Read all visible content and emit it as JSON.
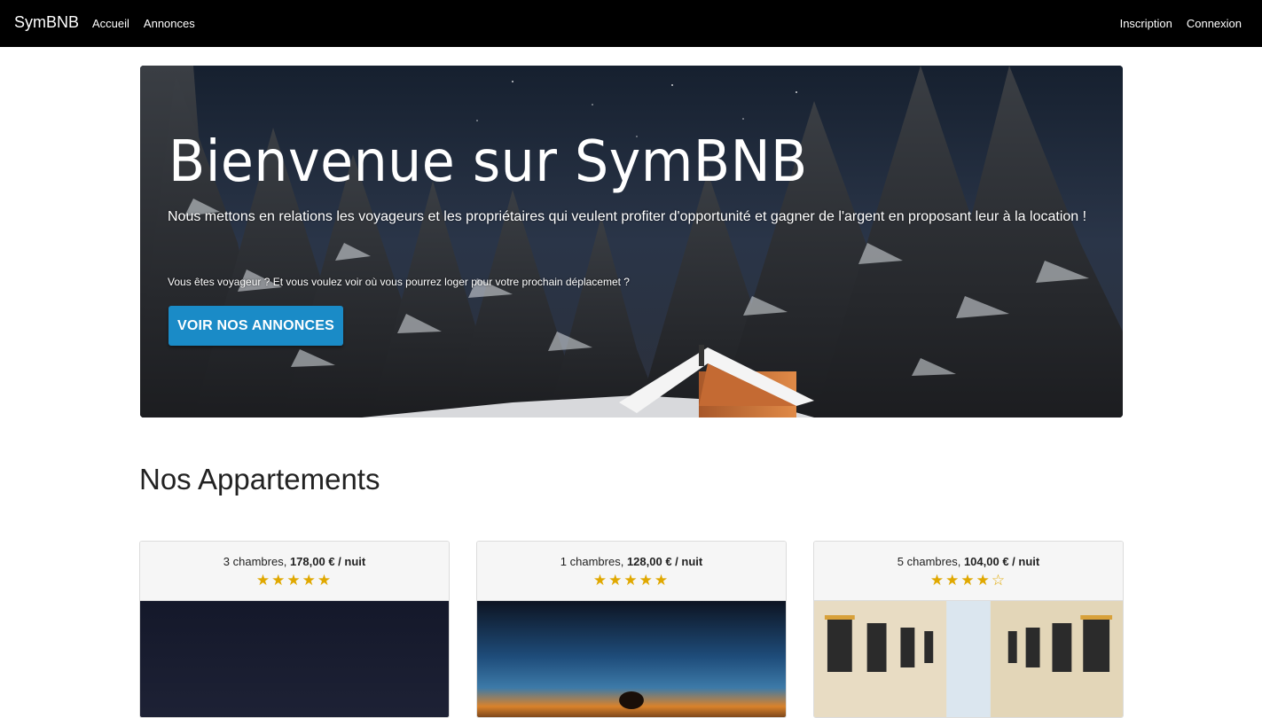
{
  "navbar": {
    "brand": "SymBNB",
    "left_links": [
      "Accueil",
      "Annonces"
    ],
    "right_links": [
      "Inscription",
      "Connexion"
    ]
  },
  "hero": {
    "title": "Bienvenue sur SymBNB",
    "lead": "Nous mettons en relations les voyageurs et les propriétaires qui veulent profiter d'opportunité et gagner de l'argent en proposant leur à la location !",
    "small": "Vous êtes voyageur ? Et vous voulez voir où vous pourrez loger pour votre prochain déplacemet ?",
    "button": "VOIR NOS ANNONCES"
  },
  "section": {
    "title": "Nos Appartements"
  },
  "cards": [
    {
      "rooms": "3 chambres,",
      "price": "178,00 € / nuit",
      "rating": 5,
      "stars": "★★★★★"
    },
    {
      "rooms": "1 chambres,",
      "price": "128,00 € / nuit",
      "rating": 5,
      "stars": "★★★★★"
    },
    {
      "rooms": "5 chambres,",
      "price": "104,00 € / nuit",
      "rating": 4,
      "stars": "★★★★☆"
    }
  ],
  "colors": {
    "navbar": "#000000",
    "button": "#1a8bc7",
    "star": "#e0a800"
  }
}
